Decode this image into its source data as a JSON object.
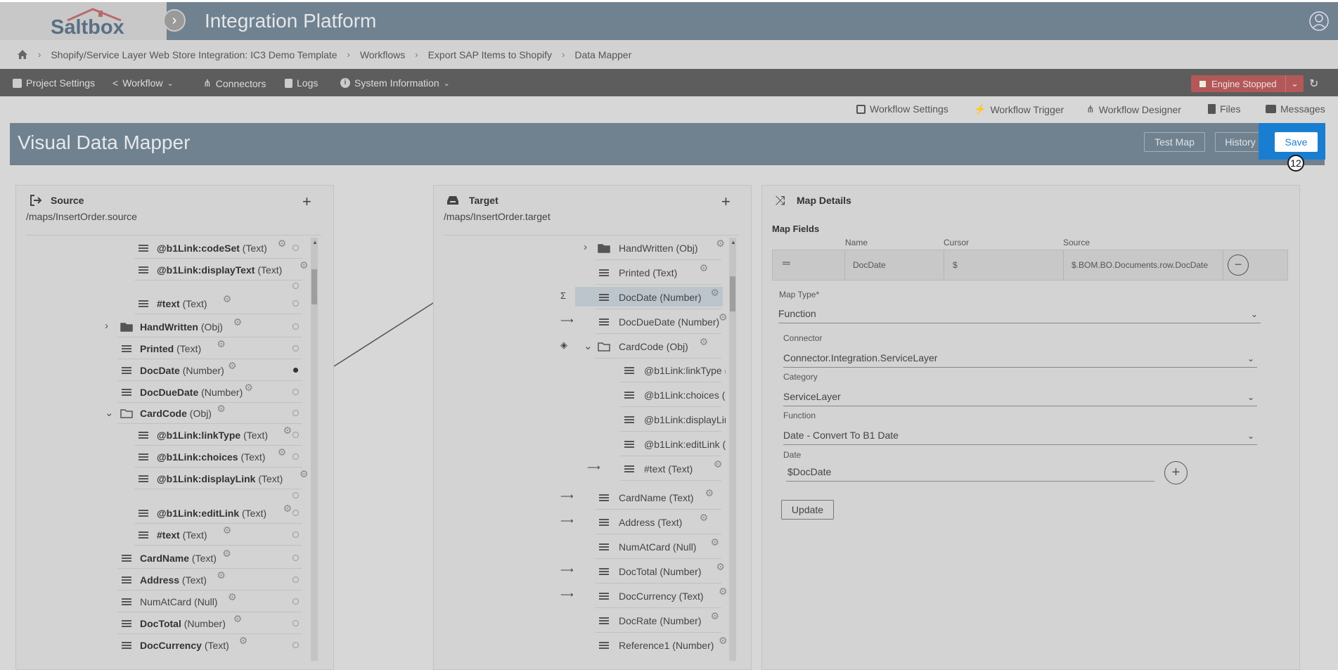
{
  "app": {
    "title": "Integration Platform",
    "logo_text": "Saltbox"
  },
  "breadcrumb": [
    "Shopify/Service Layer Web Store Integration: IC3 Demo Template",
    "Workflows",
    "Export SAP Items to Shopify",
    "Data Mapper"
  ],
  "nav": {
    "project_settings": "Project Settings",
    "workflow": "Workflow",
    "connectors": "Connectors",
    "logs": "Logs",
    "system_information": "System Information",
    "engine_status": "Engine Stopped"
  },
  "subnav": {
    "workflow_settings": "Workflow Settings",
    "workflow_trigger": "Workflow Trigger",
    "workflow_designer": "Workflow Designer",
    "files": "Files",
    "messages": "Messages"
  },
  "mapper": {
    "title": "Visual Data Mapper",
    "test_map": "Test Map",
    "history": "History",
    "save": "Save",
    "badge": "12"
  },
  "source": {
    "title": "Source",
    "path": "/maps/InsertOrder.source",
    "rows": [
      {
        "name": "@b1Link:codeSet",
        "type": "(Text)"
      },
      {
        "name": "@b1Link:displayText",
        "type": "(Text)"
      },
      {
        "name": "#text",
        "type": "(Text)"
      },
      {
        "name": "HandWritten",
        "type": "(Obj)"
      },
      {
        "name": "Printed",
        "type": "(Text)"
      },
      {
        "name": "DocDate",
        "type": "(Number)"
      },
      {
        "name": "DocDueDate",
        "type": "(Number)"
      },
      {
        "name": "CardCode",
        "type": "(Obj)"
      },
      {
        "name": "@b1Link:linkType",
        "type": "(Text)"
      },
      {
        "name": "@b1Link:choices",
        "type": "(Text)"
      },
      {
        "name": "@b1Link:displayLink",
        "type": "(Text)"
      },
      {
        "name": "@b1Link:editLink",
        "type": "(Text)"
      },
      {
        "name": "#text",
        "type": "(Text)"
      },
      {
        "name": "CardName",
        "type": "(Text)"
      },
      {
        "name": "Address",
        "type": "(Text)"
      },
      {
        "name": "NumAtCard",
        "type": "(Null)"
      },
      {
        "name": "DocTotal",
        "type": "(Number)"
      },
      {
        "name": "DocCurrency",
        "type": "(Text)"
      }
    ]
  },
  "target": {
    "title": "Target",
    "path": "/maps/InsertOrder.target",
    "rows": [
      {
        "name": "HandWritten",
        "type": "(Obj)"
      },
      {
        "name": "Printed",
        "type": "(Text)"
      },
      {
        "name": "DocDate",
        "type": "(Number)"
      },
      {
        "name": "DocDueDate",
        "type": "(Number)"
      },
      {
        "name": "CardCode",
        "type": "(Obj)"
      },
      {
        "name": "@b1Link:linkType",
        "type": "("
      },
      {
        "name": "@b1Link:choices",
        "type": "("
      },
      {
        "name": "@b1Link:displayLin",
        "type": ""
      },
      {
        "name": "@b1Link:editLink",
        "type": "("
      },
      {
        "name": "#text",
        "type": "(Text)"
      },
      {
        "name": "CardName",
        "type": "(Text)"
      },
      {
        "name": "Address",
        "type": "(Text)"
      },
      {
        "name": "NumAtCard",
        "type": "(Null)"
      },
      {
        "name": "DocTotal",
        "type": "(Number)"
      },
      {
        "name": "DocCurrency",
        "type": "(Text)"
      },
      {
        "name": "DocRate",
        "type": "(Number)"
      },
      {
        "name": "Reference1",
        "type": "(Number)"
      }
    ]
  },
  "details": {
    "title": "Map Details",
    "map_fields": "Map Fields",
    "col_name": "Name",
    "col_cursor": "Cursor",
    "col_source": "Source",
    "field_name": "DocDate",
    "field_cursor": "$",
    "field_source": "$.BOM.BO.Documents.row.DocDate",
    "map_type_label": "Map Type*",
    "map_type": "Function",
    "connector_label": "Connector",
    "connector": "Connector.Integration.ServiceLayer",
    "category_label": "Category",
    "category": "ServiceLayer",
    "function_label": "Function",
    "function": "Date - Convert To B1 Date",
    "date_label": "Date",
    "date_value": "$DocDate",
    "update": "Update"
  }
}
